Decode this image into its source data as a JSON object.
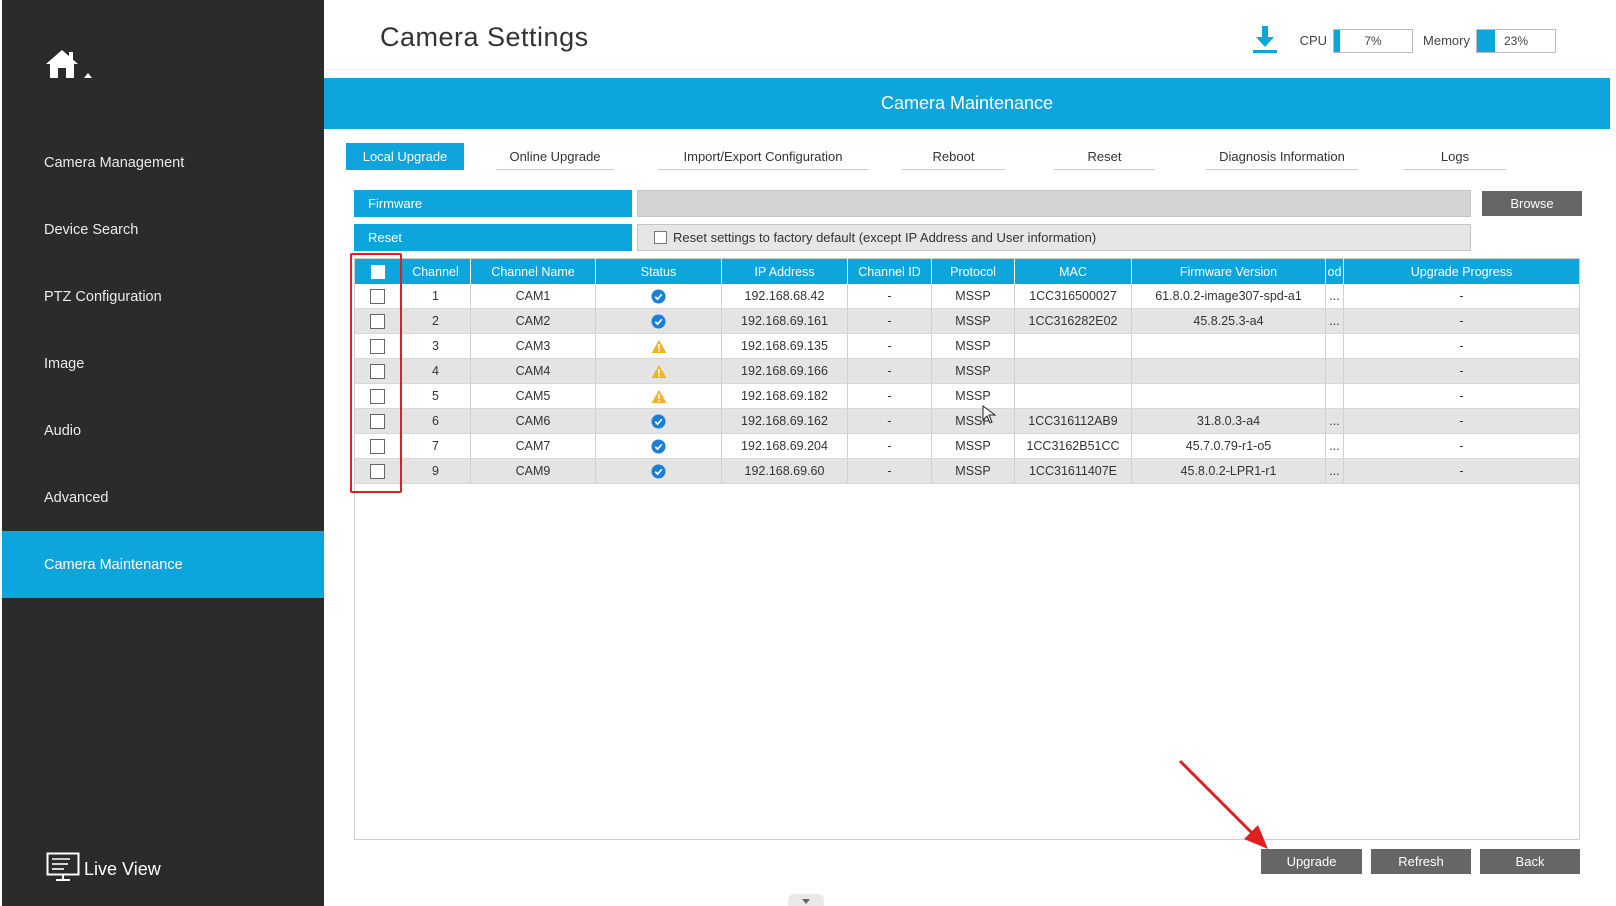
{
  "sidebar": {
    "items": [
      {
        "label": "Camera Management"
      },
      {
        "label": "Device Search"
      },
      {
        "label": "PTZ Configuration"
      },
      {
        "label": "Image"
      },
      {
        "label": "Audio"
      },
      {
        "label": "Advanced"
      },
      {
        "label": "Camera Maintenance"
      }
    ],
    "active_index": 6,
    "live_view_label": "Live View"
  },
  "header": {
    "title": "Camera Settings",
    "cpu_label": "CPU",
    "cpu_value": "7%",
    "cpu_fraction": 0.07,
    "memory_label": "Memory",
    "memory_value": "23%",
    "memory_fraction": 0.23
  },
  "banner": {
    "title": "Camera Maintenance"
  },
  "tabs": [
    {
      "label": "Local Upgrade"
    },
    {
      "label": "Online Upgrade"
    },
    {
      "label": "Import/Export Configuration"
    },
    {
      "label": "Reboot"
    },
    {
      "label": "Reset"
    },
    {
      "label": "Diagnosis Information"
    },
    {
      "label": "Logs"
    }
  ],
  "firmware": {
    "label": "Firmware",
    "browse_label": "Browse"
  },
  "reset": {
    "label": "Reset",
    "option_text": "Reset settings to factory default (except IP Address and User information)"
  },
  "table": {
    "columns": [
      "Channel",
      "Channel Name",
      "Status",
      "IP Address",
      "Channel ID",
      "Protocol",
      "MAC",
      "Firmware Version",
      "od",
      "Upgrade Progress"
    ],
    "rows": [
      {
        "channel": "1",
        "name": "CAM1",
        "status": "ok",
        "ip": "192.168.68.42",
        "channel_id": "-",
        "protocol": "MSSP",
        "mac": "1CC316500027",
        "firmware": "61.8.0.2-image307-spd-a1",
        "od": "...",
        "progress": "-"
      },
      {
        "channel": "2",
        "name": "CAM2",
        "status": "ok",
        "ip": "192.168.69.161",
        "channel_id": "-",
        "protocol": "MSSP",
        "mac": "1CC316282E02",
        "firmware": "45.8.25.3-a4",
        "od": "...",
        "progress": "-"
      },
      {
        "channel": "3",
        "name": "CAM3",
        "status": "warn",
        "ip": "192.168.69.135",
        "channel_id": "-",
        "protocol": "MSSP",
        "mac": "",
        "firmware": "",
        "od": "",
        "progress": "-"
      },
      {
        "channel": "4",
        "name": "CAM4",
        "status": "warn",
        "ip": "192.168.69.166",
        "channel_id": "-",
        "protocol": "MSSP",
        "mac": "",
        "firmware": "",
        "od": "",
        "progress": "-"
      },
      {
        "channel": "5",
        "name": "CAM5",
        "status": "warn",
        "ip": "192.168.69.182",
        "channel_id": "-",
        "protocol": "MSSP",
        "mac": "",
        "firmware": "",
        "od": "",
        "progress": "-"
      },
      {
        "channel": "6",
        "name": "CAM6",
        "status": "ok",
        "ip": "192.168.69.162",
        "channel_id": "-",
        "protocol": "MSSP",
        "mac": "1CC316112AB9",
        "firmware": "31.8.0.3-a4",
        "od": "...",
        "progress": "-"
      },
      {
        "channel": "7",
        "name": "CAM7",
        "status": "ok",
        "ip": "192.168.69.204",
        "channel_id": "-",
        "protocol": "MSSP",
        "mac": "1CC3162B51CC",
        "firmware": "45.7.0.79-r1-o5",
        "od": "...",
        "progress": "-"
      },
      {
        "channel": "9",
        "name": "CAM9",
        "status": "ok",
        "ip": "192.168.69.60",
        "channel_id": "-",
        "protocol": "MSSP",
        "mac": "1CC31611407E",
        "firmware": "45.8.0.2-LPR1-r1",
        "od": "...",
        "progress": "-"
      }
    ]
  },
  "buttons": {
    "upgrade": "Upgrade",
    "refresh": "Refresh",
    "back": "Back"
  },
  "colors": {
    "accent": "#0ea5dd",
    "sidebar": "#2b2b2b",
    "ok": "#1a7fd6",
    "warn": "#f0b323",
    "annotation": "#e02020"
  },
  "icons": {
    "home": "home-icon",
    "download": "download-icon",
    "live_view": "monitor-icon",
    "status_ok": "check-circle-icon",
    "status_warn": "warning-icon"
  }
}
